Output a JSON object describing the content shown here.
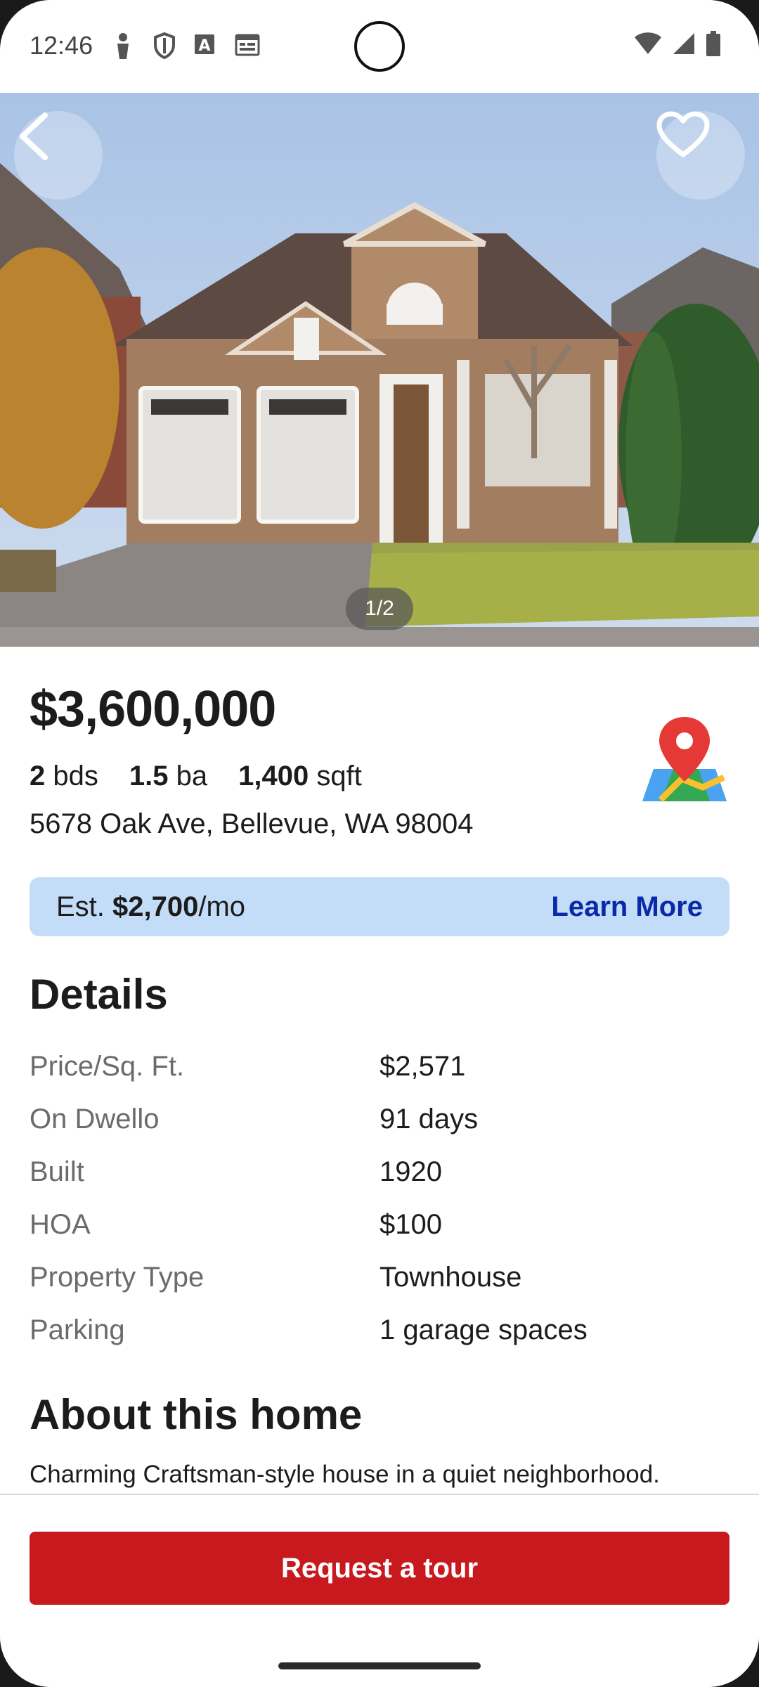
{
  "status_bar": {
    "time": "12:46",
    "left_icons": [
      "person-icon",
      "shield-icon",
      "text-a-icon",
      "calendar-icon"
    ],
    "right_icons": [
      "wifi-icon",
      "signal-icon",
      "battery-icon"
    ]
  },
  "hero": {
    "photo_counter": "1/2",
    "back_icon": "chevron-left-icon",
    "favorite_icon": "heart-outline-icon"
  },
  "listing": {
    "price": "$3,600,000",
    "beds_value": "2",
    "beds_unit": "bds",
    "baths_value": "1.5",
    "baths_unit": "ba",
    "sqft_value": "1,400",
    "sqft_unit": "sqft",
    "address": "5678 Oak Ave, Bellevue, WA 98004",
    "map_icon": "map-pin-icon"
  },
  "estimate": {
    "prefix": "Est.",
    "amount": "$2,700",
    "suffix": "/mo",
    "link_label": "Learn More"
  },
  "details": {
    "title": "Details",
    "rows": [
      {
        "label": "Price/Sq. Ft.",
        "value": "$2,571"
      },
      {
        "label": "On Dwello",
        "value": "91 days"
      },
      {
        "label": "Built",
        "value": "1920"
      },
      {
        "label": "HOA",
        "value": "$100"
      },
      {
        "label": "Property Type",
        "value": "Townhouse"
      },
      {
        "label": "Parking",
        "value": "1 garage spaces"
      }
    ]
  },
  "about": {
    "title": "About this home",
    "text": "Charming Craftsman-style house in a quiet neighborhood."
  },
  "actions": {
    "tour_label": "Request a tour"
  },
  "colors": {
    "accent_red": "#c8191e",
    "estimate_bg": "#c3dcf8",
    "link_blue": "#0b2aa8"
  }
}
